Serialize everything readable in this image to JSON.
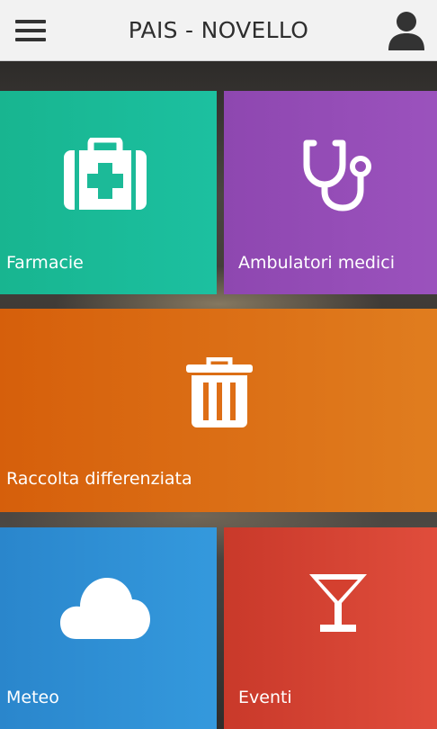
{
  "header": {
    "title": "PAIS - NOVELLO",
    "menu_icon": "hamburger-menu-icon",
    "user_icon": "user-account-icon"
  },
  "tiles": [
    {
      "label": "Farmacie",
      "icon": "first-aid-kit-icon",
      "color": "#1abc9c"
    },
    {
      "label": "Ambulatori medici",
      "icon": "stethoscope-icon",
      "color": "#9b59b6"
    },
    {
      "label": "Raccolta differenziata",
      "icon": "trash-bin-icon",
      "color": "#e06c12"
    },
    {
      "label": "Meteo",
      "icon": "cloud-icon",
      "color": "#3191d6"
    },
    {
      "label": "Eventi",
      "icon": "cocktail-glass-icon",
      "color": "#d84434"
    }
  ]
}
